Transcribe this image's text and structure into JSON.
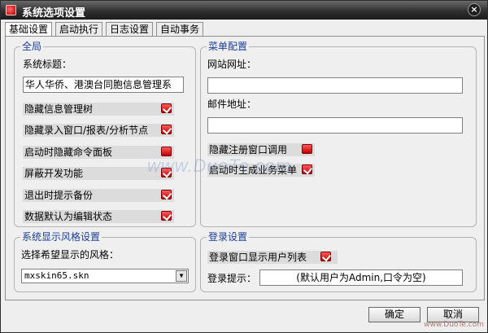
{
  "window": {
    "title": "系统选项设置",
    "close_glyph": "×"
  },
  "tabs": [
    {
      "label": "基础设置",
      "active": true
    },
    {
      "label": "启动执行",
      "active": false
    },
    {
      "label": "日志设置",
      "active": false
    },
    {
      "label": "自动事务",
      "active": false
    }
  ],
  "global": {
    "legend": "全局",
    "system_title_label": "系统标题：",
    "system_title_value": "华人华侨、港澳台同胞信息管理系",
    "options": [
      {
        "label": "隐藏信息管理树",
        "checked": true
      },
      {
        "label": "隐藏录入窗口/报表/分析节点",
        "checked": true
      },
      {
        "label": "启动时隐藏命令面板",
        "checked": false
      },
      {
        "label": "屏蔽开发功能",
        "checked": true
      },
      {
        "label": "退出时提示备份",
        "checked": true
      },
      {
        "label": "数据默认为编辑状态",
        "checked": true
      }
    ]
  },
  "menu": {
    "legend": "菜单配置",
    "website_label": "网站网址：",
    "website_value": "",
    "email_label": "邮件地址：",
    "email_value": "",
    "options": [
      {
        "label": "隐藏注册窗口调用",
        "checked": false
      },
      {
        "label": "启动时生成业务菜单",
        "checked": true
      }
    ]
  },
  "skin": {
    "legend": "系统显示风格设置",
    "choose_label": "选择希望显示的风格：",
    "selected": "mxskin65.skn",
    "dropdown_glyph": "▼"
  },
  "login": {
    "legend": "登录设置",
    "show_users_label": "登录窗口显示用户列表",
    "show_users_checked": true,
    "hint_label": "登录提示：",
    "hint_value": "(默认用户为Admin,口令为空)"
  },
  "buttons": {
    "ok": "确定",
    "cancel": "取消"
  },
  "watermark": "www.DuoTe.com",
  "corner_watermark": "www.DuoTe.com",
  "colors": {
    "legend": "#1c3f9a",
    "check": "#c00000",
    "titlebar": "#2f2f2f"
  }
}
